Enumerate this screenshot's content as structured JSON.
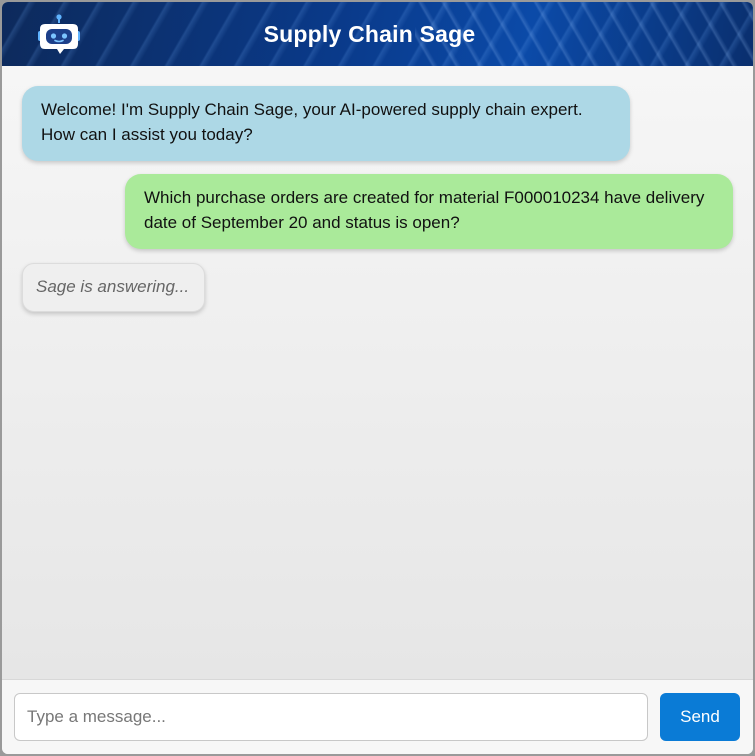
{
  "header": {
    "title": "Supply Chain Sage",
    "logo_icon": "robot-chat-icon",
    "accent_color": "#0a3a8a"
  },
  "messages": [
    {
      "role": "bot",
      "text": "Welcome! I'm Supply Chain Sage, your AI-powered supply chain expert. How can I assist you today?",
      "color": "#add8e6"
    },
    {
      "role": "user",
      "text": "Which purchase orders are created for material F000010234 have delivery date of September 20 and status is open?",
      "color": "#aaea9a"
    }
  ],
  "status": {
    "typing_text": "Sage is answering..."
  },
  "composer": {
    "placeholder": "Type a message...",
    "value": "",
    "send_label": "Send",
    "send_color": "#0a7bd6"
  }
}
